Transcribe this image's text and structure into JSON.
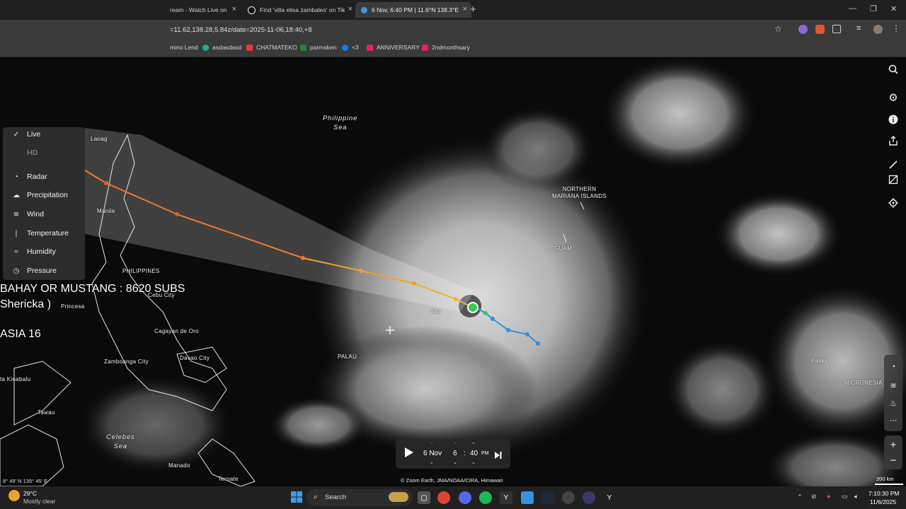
{
  "browser": {
    "tabs": [
      {
        "label": "ream - Watch Live on",
        "active": false,
        "icon": "stream-icon"
      },
      {
        "label": "Find 'villa elisa zambales' on Tik",
        "active": false,
        "icon": "tiktok-icon"
      },
      {
        "label": "6 Nov, 6:40 PM | 11.6°N 138.3°E",
        "active": true,
        "icon": "globe-icon"
      }
    ],
    "new_tab": "+",
    "url": "=11.62,138.28,5.84z/date=2025-11-06,18:40,+8",
    "bookmarks": [
      {
        "label": "mino Lend",
        "color": "#3a3a3a"
      },
      {
        "label": "asdasdasd",
        "color": "#19b19b"
      },
      {
        "label": "CHATMATEKO",
        "color": "#e53935"
      },
      {
        "label": "parmsken",
        "color": "#2e7d32"
      },
      {
        "label": "<3",
        "color": "#1877f2"
      },
      {
        "label": "ANNIVERSARY",
        "color": "#e91e63"
      },
      {
        "label": "2ndmonthsary",
        "color": "#e91e63"
      }
    ],
    "window_controls": {
      "minimize": "—",
      "restore": "❐",
      "close": "✕"
    }
  },
  "layer_menu": {
    "items": [
      {
        "label": "Live",
        "icon": "check-icon",
        "glyph": "✓",
        "dim": false
      },
      {
        "label": "HD",
        "icon": "",
        "glyph": "",
        "dim": true
      },
      {
        "label": "Radar",
        "icon": "radar-icon",
        "glyph": "◔",
        "dim": false
      },
      {
        "label": "Precipitation",
        "icon": "precipitation-icon",
        "glyph": "☁",
        "dim": false
      },
      {
        "label": "Wind",
        "icon": "wind-icon",
        "glyph": "≋",
        "dim": false
      },
      {
        "label": "Temperature",
        "icon": "thermometer-icon",
        "glyph": "🌡",
        "dim": false
      },
      {
        "label": "Humidity",
        "icon": "humidity-icon",
        "glyph": "≈",
        "dim": false
      },
      {
        "label": "Pressure",
        "icon": "gauge-icon",
        "glyph": "◷",
        "dim": false
      }
    ]
  },
  "overlay": {
    "line1": "BAHAY OR MUSTANG : 8620 SUBS",
    "line2": "Shericka )",
    "line3": "ASIA 16"
  },
  "map": {
    "sea_labels": [
      {
        "text": "Philippine\nSea"
      },
      {
        "text": "Celebes\nSea"
      }
    ],
    "place_labels": {
      "laoag": "Laoag",
      "manila": "Manila",
      "philippines": "PHILIPPINES",
      "cebu": "Cebu City",
      "princesa": "Princesa",
      "cagayan": "Cagayan de Oro",
      "zamboanga": "Zamboanga City",
      "davao": "Davao City",
      "kinabalu": "ta Kinabalu",
      "tawau": "Tawau",
      "manado": "Manado",
      "ternate": "Ternate",
      "palau": "PALAU",
      "yap": "Yap",
      "guam": "GUAM",
      "northern_mariana": "NORTHERN\nMARIANA ISLANDS",
      "palikir": "Palikir",
      "micronesia": "MICRONESIA"
    },
    "coords": "8° 49' N    135° 45' E",
    "attribution": "© Zoom Earth, JMA/NOAA/CIRA, Himawari",
    "scale": "200 km",
    "track_colors": {
      "past": "#2f8fe6",
      "current": "#35c95a",
      "forecast_yellow": "#f0b429",
      "forecast_orange": "#f07a2a",
      "forecast_red": "#e55a2b"
    }
  },
  "time_control": {
    "play_icon": "play-icon",
    "date": "6 Nov",
    "hour": "6",
    "separator": ":",
    "minute": "40",
    "ampm": "PM",
    "next_icon": "skip-next-icon"
  },
  "taskbar": {
    "weather_temp": "29°C",
    "weather_desc": "Mostly clear",
    "search": "Search",
    "time": "7:10:30 PM",
    "date": "11/6/2025"
  }
}
